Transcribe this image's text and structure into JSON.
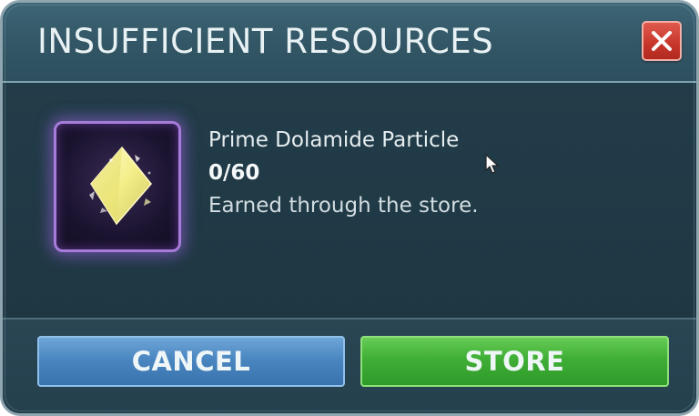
{
  "dialog": {
    "title": "INSUFFICIENT RESOURCES",
    "close_icon": "close-x-icon"
  },
  "item": {
    "icon": "diamond-crystal-icon",
    "name": "Prime Dolamide Particle",
    "count": "0/60",
    "description": "Earned through the store."
  },
  "buttons": {
    "cancel_label": "CANCEL",
    "store_label": "STORE"
  },
  "colors": {
    "header": "#335766",
    "body": "#213b48",
    "close_button": "#c8352a",
    "cancel_button": "#4a86c0",
    "store_button": "#3fae36",
    "item_glow": "#a77bd9",
    "crystal": "#f4ee8a"
  }
}
